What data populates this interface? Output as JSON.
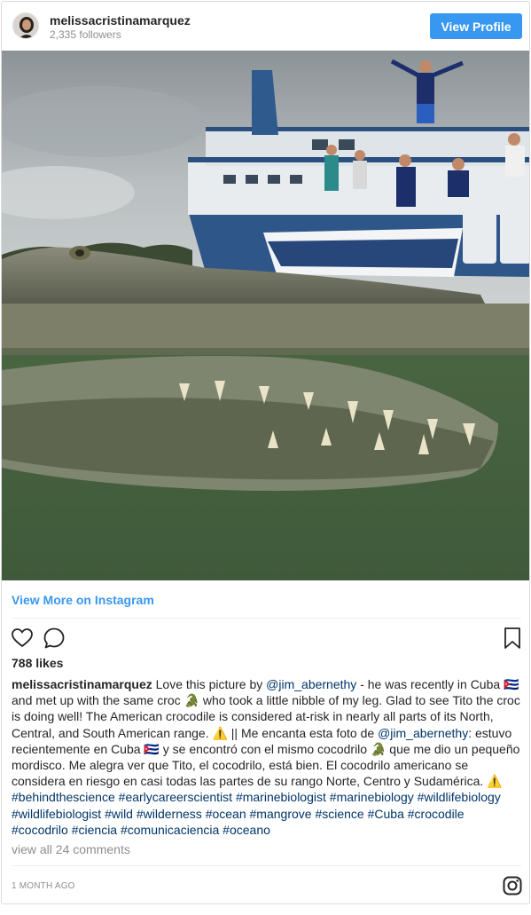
{
  "header": {
    "username": "melissacristinamarquez",
    "followers": "2,335 followers",
    "view_profile_label": "View Profile"
  },
  "photo": {
    "alt": "crocodile-and-boat-over-under-photo"
  },
  "links": {
    "view_more": "View More on Instagram"
  },
  "actions": {
    "icons": [
      "heart-icon",
      "comment-icon",
      "bookmark-icon"
    ]
  },
  "likes": "788 likes",
  "caption": {
    "user": "melissacristinamarquez",
    "t1": " Love this picture by ",
    "m1": "@jim_abernethy",
    "t2": " - he was recently in Cuba 🇨🇺 and met up with the same croc 🐊 who took a little nibble of my leg. Glad to see Tito the croc is doing well! The American crocodile is considered at-risk in nearly all parts of its North, Central, and South American range. ⚠️ || Me encanta esta foto de ",
    "m2": "@jim_abernethy",
    "t3": ": estuvo recientemente en Cuba 🇨🇺 y se encontró con el mismo cocodrilo 🐊 que me dio un pequeño mordisco. Me alegra ver que Tito, el cocodrilo, está bien. El cocodrilo americano se considera en riesgo en casi todas las partes de su rango Norte, Centro y Sudamérica. ⚠️ ",
    "hashtags": [
      "#behindthescience",
      "#earlycareerscientist",
      "#marinebiologist",
      "#marinebiology",
      "#wildlifebiology",
      "#wildlifebiologist",
      "#wild",
      "#wilderness",
      "#ocean",
      "#mangrove",
      "#science",
      "#Cuba",
      "#crocodile",
      "#cocodrilo",
      "#ciencia",
      "#comunicaciencia",
      "#oceano"
    ]
  },
  "comments_link": "view all 24 comments",
  "timestamp": "1 MONTH AGO",
  "colors": {
    "accent": "#3897f0",
    "hashtag": "#003569",
    "muted": "#8e8e8e"
  }
}
